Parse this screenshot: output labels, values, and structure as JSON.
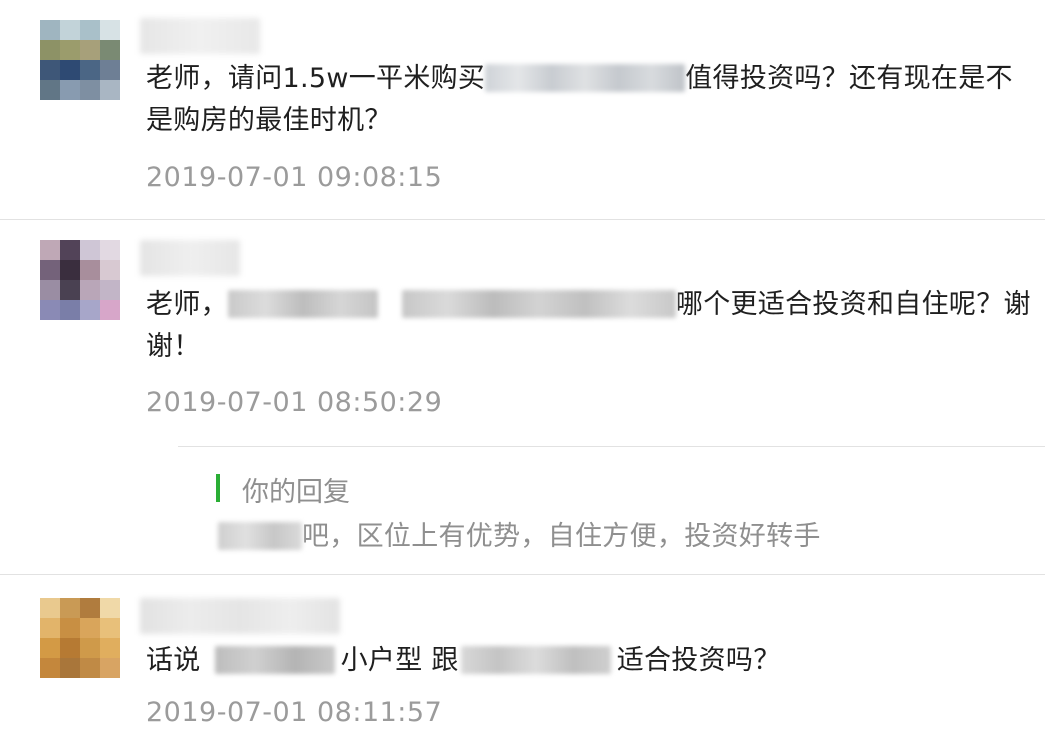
{
  "comments": [
    {
      "text_prefix": "老师，请问1.5w一平米购买",
      "text_suffix": "值得投资吗？还有现在是不是购房的最佳时机？",
      "time": "2019-07-01 09:08:15"
    },
    {
      "text_prefix": "老师，",
      "text_suffix": "哪个更适合投资和自住呢？谢谢！",
      "time": "2019-07-01 08:50:29",
      "reply": {
        "title": "你的回复",
        "text": "吧，区位上有优势，自住方便，投资好转手"
      }
    },
    {
      "text_prefix": "话说",
      "text_middle": "小户型 跟",
      "text_suffix": "适合投资吗？",
      "time": "2019-07-01 08:11:57"
    }
  ],
  "colors": {
    "reply_bar": "#2aae35",
    "time_text": "#9b9b9b",
    "divider": "#e2e2e2"
  }
}
